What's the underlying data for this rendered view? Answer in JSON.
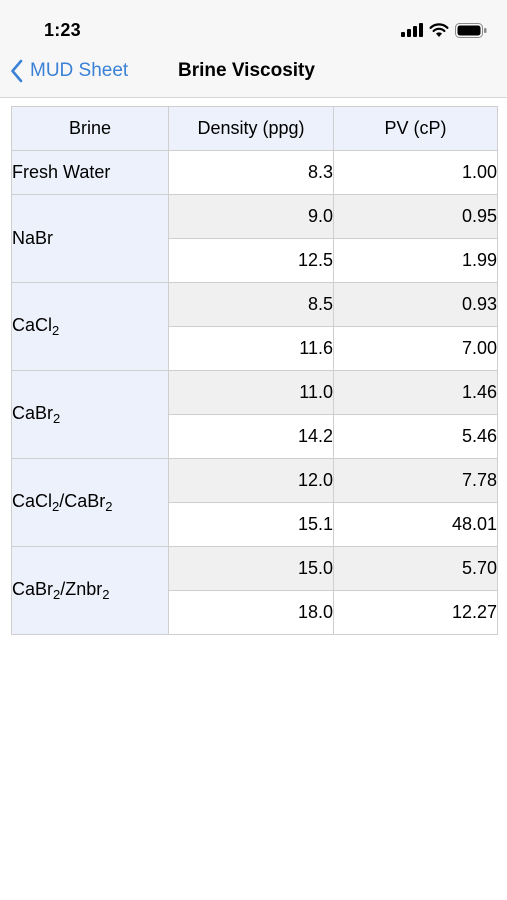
{
  "status_bar": {
    "time": "1:23"
  },
  "nav": {
    "back_label": "MUD Sheet",
    "title": "Brine Viscosity"
  },
  "table": {
    "headers": [
      "Brine",
      "Density (ppg)",
      "PV (cP)"
    ],
    "groups": [
      {
        "brine": "Fresh Water",
        "rows": [
          {
            "density": "8.3",
            "pv": "1.00"
          }
        ]
      },
      {
        "brine": "NaBr",
        "rows": [
          {
            "density": "9.0",
            "pv": "0.95"
          },
          {
            "density": "12.5",
            "pv": "1.99"
          }
        ]
      },
      {
        "brine": "CaCl2",
        "brine_parts": [
          "CaCl",
          "2"
        ],
        "rows": [
          {
            "density": "8.5",
            "pv": "0.93"
          },
          {
            "density": "11.6",
            "pv": "7.00"
          }
        ]
      },
      {
        "brine": "CaBr2",
        "brine_parts": [
          "CaBr",
          "2"
        ],
        "rows": [
          {
            "density": "11.0",
            "pv": "1.46"
          },
          {
            "density": "14.2",
            "pv": "5.46"
          }
        ]
      },
      {
        "brine": "CaCl2/CaBr2",
        "brine_parts": [
          "CaCl",
          "2",
          "/CaBr",
          "2"
        ],
        "rows": [
          {
            "density": "12.0",
            "pv": "7.78"
          },
          {
            "density": "15.1",
            "pv": "48.01"
          }
        ]
      },
      {
        "brine": "CaBr2/Znbr2",
        "brine_parts": [
          "CaBr",
          "2",
          "/Znbr",
          "2"
        ],
        "rows": [
          {
            "density": "15.0",
            "pv": "5.70"
          },
          {
            "density": "18.0",
            "pv": "12.27"
          }
        ]
      }
    ]
  },
  "colors": {
    "accent": "#3b82d6",
    "header_bg": "#edf1fb",
    "row_shade": "#f0f0f0",
    "border": "#cfcfcf"
  },
  "icons": [
    "signal-icon",
    "wifi-icon",
    "battery-icon",
    "chevron-left-icon"
  ]
}
